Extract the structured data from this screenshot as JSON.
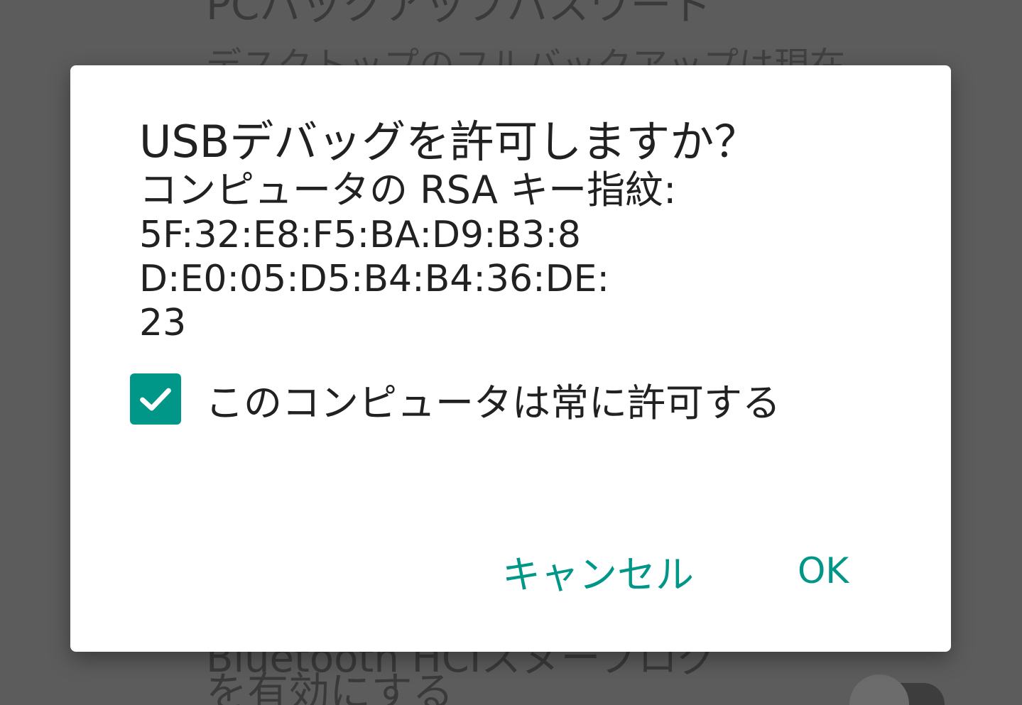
{
  "background": {
    "top_title": "PCバックアップパスワード",
    "top_summary": "デスクトップのフルバックアップは現在",
    "bottom_title_line1": "Bluetooth HCIスヌープログ",
    "bottom_title_line2": "を有効にする"
  },
  "dialog": {
    "title": "USBデバッグを許可しますか？",
    "subtitle": "コンピュータの RSA キー指紋:",
    "fingerprint": "5F:32:E8:F5:BA:D9:B3:8\nD:E0:05:D5:B4:B4:36:DE:\n23",
    "checkbox": {
      "label": "このコンピュータは常に許可する",
      "checked": true,
      "color": "#009688"
    },
    "buttons": {
      "cancel": "キャンセル",
      "ok": "OK",
      "color": "#009688"
    }
  }
}
